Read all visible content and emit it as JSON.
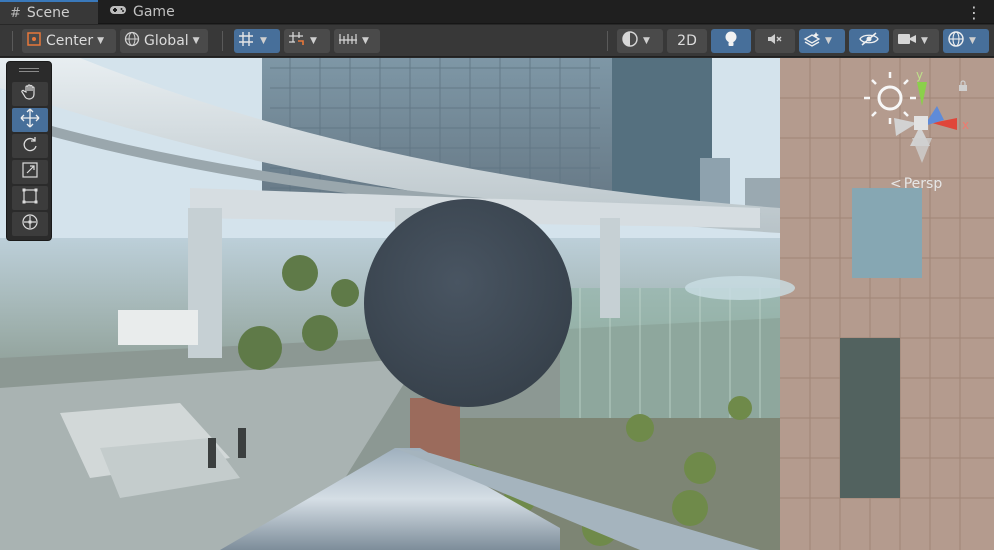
{
  "tabs": [
    {
      "label": "Scene",
      "icon": "grid-icon"
    },
    {
      "label": "Game",
      "icon": "gamepad-icon"
    }
  ],
  "toolbar": {
    "pivot_label": "Center",
    "space_label": "Global",
    "mode_2d_label": "2D"
  },
  "gizmo": {
    "y_label": "y",
    "x_label": "x",
    "projection_label": "Persp"
  },
  "colors": {
    "accent": "#476f9a",
    "tab_highlight": "#3a79bb",
    "sphere": "#3f4a56"
  }
}
